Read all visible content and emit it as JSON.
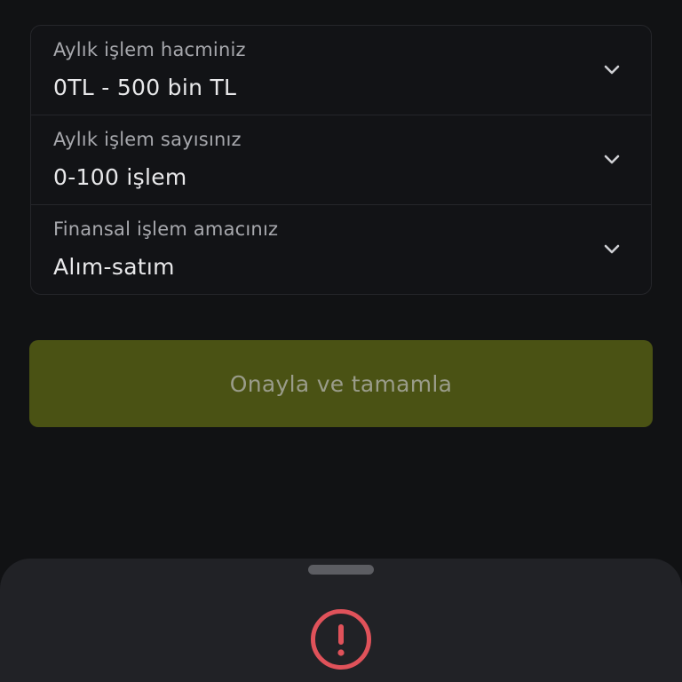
{
  "form": {
    "fields": [
      {
        "label": "Aylık işlem hacminiz",
        "value": "0TL - 500 bin TL",
        "icon": "chevron-down-icon"
      },
      {
        "label": "Aylık işlem sayısınız",
        "value": "0-100 işlem",
        "icon": "chevron-down-icon"
      },
      {
        "label": "Finansal işlem amacınız",
        "value": "Alım-satım",
        "icon": "chevron-down-icon"
      }
    ]
  },
  "actions": {
    "confirm_label": "Onayla ve tamamla"
  },
  "sheet": {
    "icon": "alert-circle-icon"
  },
  "colors": {
    "background": "#111214",
    "button": "#4a5214",
    "alert": "#e0525a",
    "sheet": "#212226"
  }
}
